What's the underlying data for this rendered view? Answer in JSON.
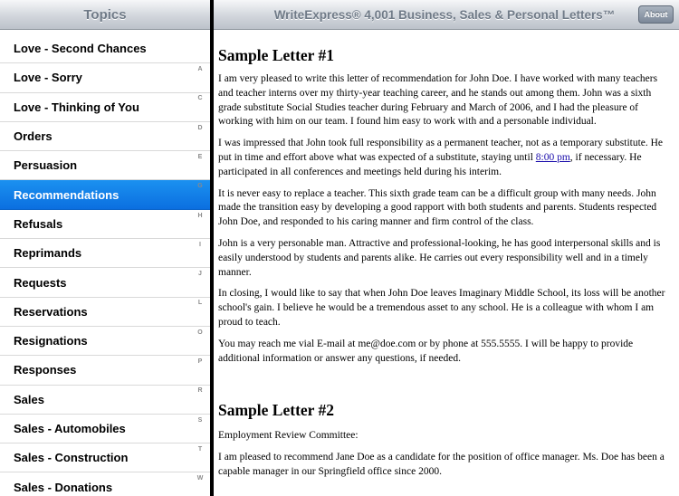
{
  "sidebar": {
    "title": "Topics",
    "items": [
      {
        "label": "Love - Second Chances",
        "selected": false
      },
      {
        "label": "Love - Sorry",
        "selected": false
      },
      {
        "label": "Love - Thinking of You",
        "selected": false
      },
      {
        "label": "Orders",
        "selected": false
      },
      {
        "label": "Persuasion",
        "selected": false
      },
      {
        "label": "Recommendations",
        "selected": true
      },
      {
        "label": "Refusals",
        "selected": false
      },
      {
        "label": "Reprimands",
        "selected": false
      },
      {
        "label": "Requests",
        "selected": false
      },
      {
        "label": "Reservations",
        "selected": false
      },
      {
        "label": "Resignations",
        "selected": false
      },
      {
        "label": "Responses",
        "selected": false
      },
      {
        "label": "Sales",
        "selected": false
      },
      {
        "label": "Sales - Automobiles",
        "selected": false
      },
      {
        "label": "Sales - Construction",
        "selected": false
      },
      {
        "label": "Sales - Donations",
        "selected": false
      }
    ],
    "index_letters": [
      "A",
      "C",
      "D",
      "E",
      "G",
      "H",
      "I",
      "J",
      "L",
      "O",
      "P",
      "R",
      "S",
      "T",
      "W"
    ]
  },
  "header": {
    "title": "WriteExpress® 4,001 Business, Sales & Personal Letters™",
    "about_label": "About"
  },
  "letters": [
    {
      "heading": "Sample Letter #1",
      "p1": "I am very pleased to write this letter of recommendation for John Doe. I have worked with many teachers and teacher interns over my thirty-year teaching career, and he stands out among them. John was a sixth grade substitute Social Studies teacher during February and March of 2006, and I had the pleasure of working with him on our team. I found him easy to work with and a personable individual.",
      "p2_before": "I was impressed that John took full responsibility as a permanent teacher, not as a temporary substitute. He put in time and effort above what was expected of a substitute, staying until ",
      "p2_link": "8:00 pm",
      "p2_after": ", if necessary. He participated in all conferences and meetings held during his interim.",
      "p3": "It is never easy to replace a teacher. This sixth grade team can be a difficult group with many needs. John made the transition easy by developing a good rapport with both students and parents. Students respected John Doe, and responded to his caring manner and firm control of the class.",
      "p4": "John is a very personable man. Attractive and professional-looking, he has good interpersonal skills and is easily understood by students and parents alike. He carries out every responsibility well and in a timely manner.",
      "p5": "In closing, I would like to say that when John Doe leaves Imaginary Middle School, its loss will be another school's gain. I believe he would be a tremendous asset to any school. He is a colleague with whom I am proud to teach.",
      "p6": "You may reach me vial E-mail at me@doe.com or by phone at 555.5555. I will be happy to provide additional information or answer any questions, if needed."
    },
    {
      "heading": "Sample Letter #2",
      "p1": "Employment Review Committee:",
      "p2": "I am pleased to recommend Jane Doe as a candidate for the position of office manager. Ms. Doe has been a capable manager in our Springfield office since 2000."
    }
  ]
}
